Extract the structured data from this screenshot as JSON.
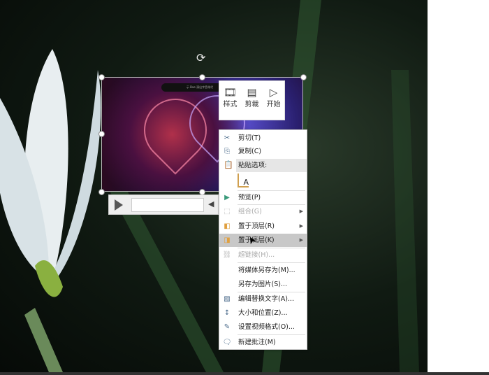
{
  "video": {
    "title_bar": "示 Bae 演出字音带代"
  },
  "mini_toolbar": [
    {
      "icon": "video-style-icon",
      "label": "样式"
    },
    {
      "icon": "trim-icon",
      "label": "剪裁"
    },
    {
      "icon": "start-icon",
      "label": "开始"
    }
  ],
  "context_menu": {
    "cut": "剪切(T)",
    "copy": "复制(C)",
    "paste_options": "粘贴选项:",
    "paste_icon": "A",
    "preview": "预览(P)",
    "group": "组合(G)",
    "bring_front": "置于顶层(R)",
    "send_back": "置于底层(K)",
    "hyperlink": "超链接(H)...",
    "save_media": "将媒体另存为(M)...",
    "save_picture": "另存为图片(S)...",
    "alt_text": "编辑替换文字(A)...",
    "size_position": "大小和位置(Z)...",
    "format_video": "设置视频格式(O)...",
    "new_comment": "新建批注(M)"
  }
}
